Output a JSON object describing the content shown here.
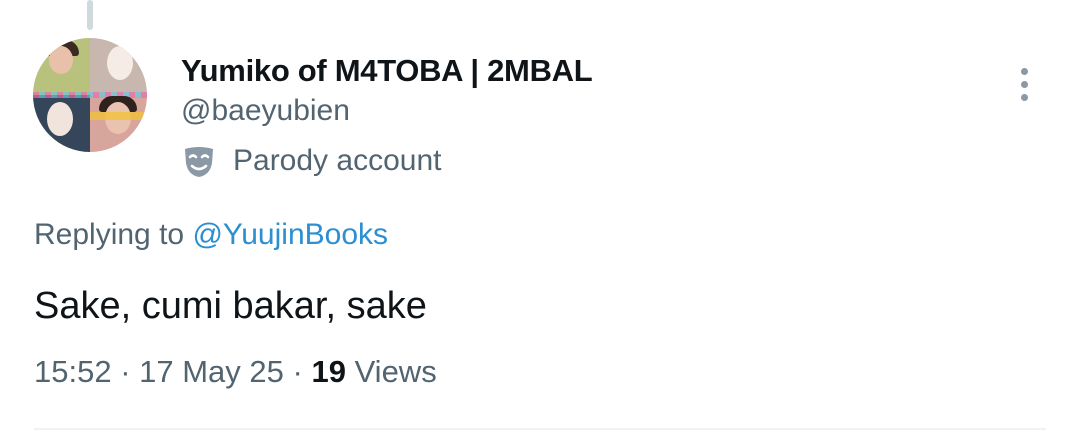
{
  "author": {
    "display_name": "Yumiko of M4TOBA | 2MBAL",
    "handle": "@baeyubien",
    "label": "Parody account",
    "label_icon": "theater-mask-icon"
  },
  "menu": {
    "icon": "more-options-icon"
  },
  "reply": {
    "prefix": "Replying to ",
    "mention": "@YuujinBooks"
  },
  "tweet": {
    "text": "Sake, cumi bakar, sake"
  },
  "meta": {
    "time": "15:52",
    "separator1": " · ",
    "date": "17 May 25",
    "separator2": " · ",
    "views_count": "19",
    "views_label": " Views"
  },
  "colors": {
    "primary_text": "#0f1419",
    "secondary_text": "#536471",
    "mention": "#2b8fd1",
    "divider": "#eff3f4"
  }
}
